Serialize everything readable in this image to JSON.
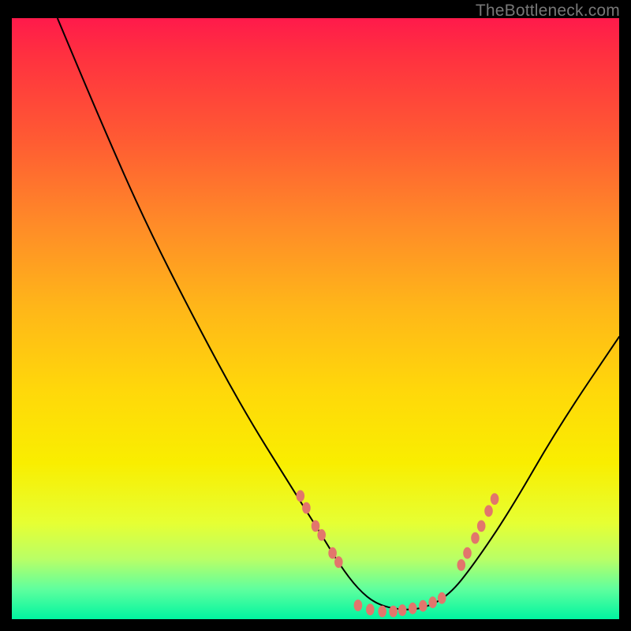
{
  "watermark": "TheBottleneck.com",
  "colors": {
    "background": "#000000",
    "curve": "#000000",
    "dots": "#e2766c"
  },
  "chart_data": {
    "type": "line",
    "title": "",
    "xlabel": "",
    "ylabel": "",
    "xlim": [
      0,
      100
    ],
    "ylim": [
      0,
      100
    ],
    "annotations": [
      "TheBottleneck.com"
    ],
    "series": [
      {
        "name": "curve",
        "x": [
          7.5,
          15,
          22,
          30,
          38,
          46,
          51,
          54,
          57,
          60,
          64,
          68,
          72,
          76,
          82,
          90,
          100
        ],
        "y": [
          100,
          82,
          66,
          50,
          35,
          22,
          14,
          9,
          5,
          2.5,
          1.5,
          1.8,
          4,
          9,
          18,
          32,
          47
        ]
      }
    ],
    "markers": {
      "left_cluster": [
        {
          "x": 47.5,
          "y": 20.5
        },
        {
          "x": 48.5,
          "y": 18.5
        },
        {
          "x": 50.0,
          "y": 15.5
        },
        {
          "x": 51.0,
          "y": 14.0
        },
        {
          "x": 52.8,
          "y": 11.0
        },
        {
          "x": 53.8,
          "y": 9.5
        }
      ],
      "bottom_cluster": [
        {
          "x": 57.0,
          "y": 2.3
        },
        {
          "x": 59.0,
          "y": 1.6
        },
        {
          "x": 61.0,
          "y": 1.3
        },
        {
          "x": 62.8,
          "y": 1.3
        },
        {
          "x": 64.3,
          "y": 1.5
        },
        {
          "x": 66.0,
          "y": 1.8
        },
        {
          "x": 67.7,
          "y": 2.2
        },
        {
          "x": 69.3,
          "y": 2.8
        },
        {
          "x": 70.8,
          "y": 3.5
        }
      ],
      "right_cluster": [
        {
          "x": 74.0,
          "y": 9.0
        },
        {
          "x": 75.0,
          "y": 11.0
        },
        {
          "x": 76.3,
          "y": 13.5
        },
        {
          "x": 77.3,
          "y": 15.5
        },
        {
          "x": 78.5,
          "y": 18.0
        },
        {
          "x": 79.5,
          "y": 20.0
        }
      ]
    }
  }
}
